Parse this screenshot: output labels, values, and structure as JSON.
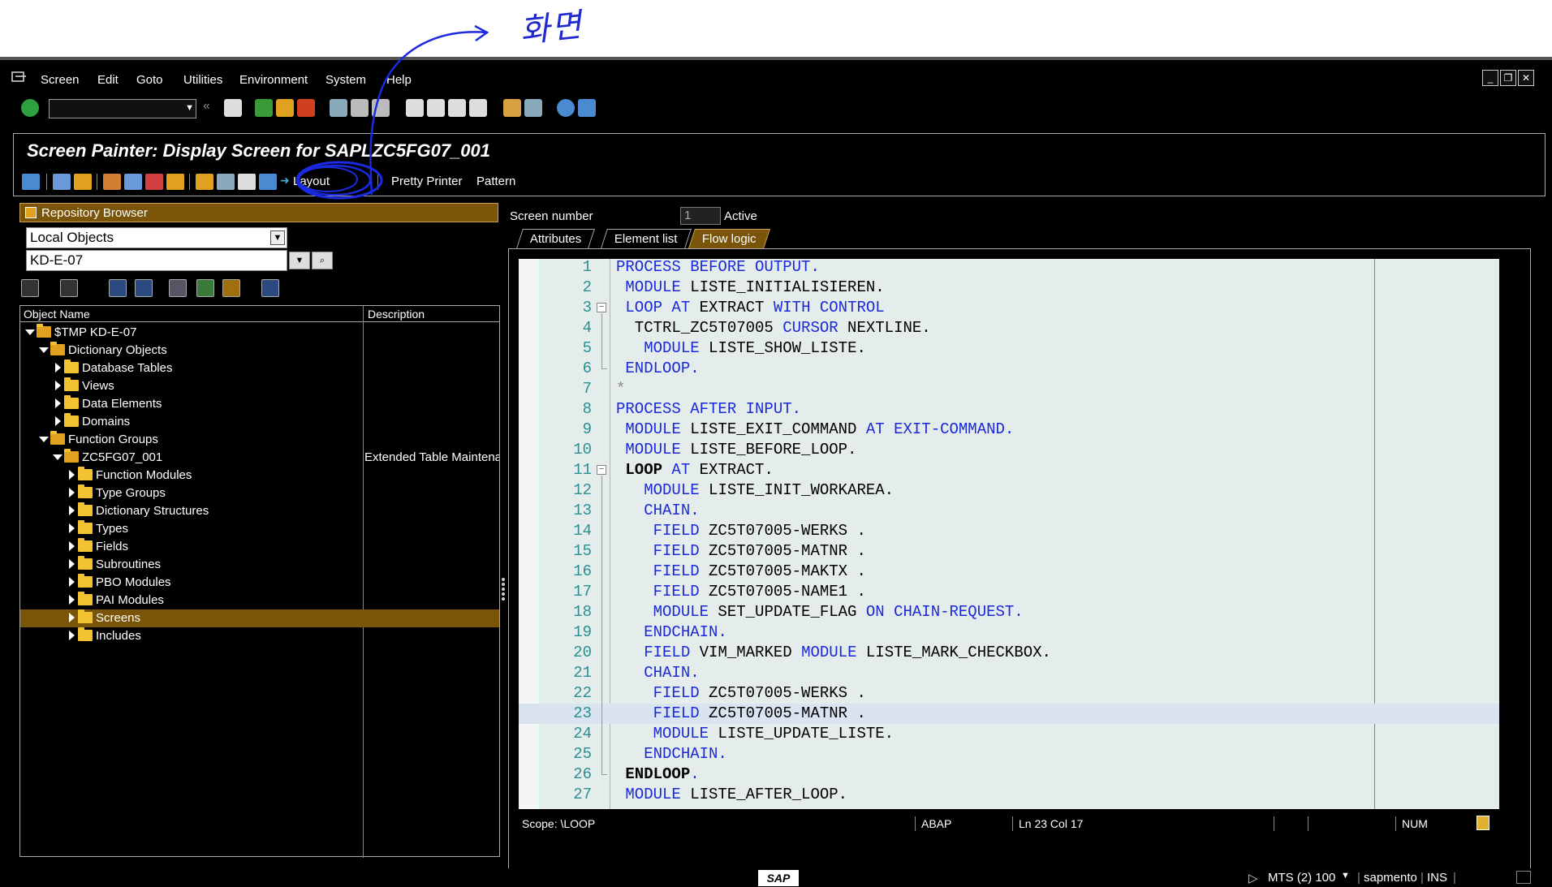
{
  "annotation": {
    "handwriting": "화면"
  },
  "menubar": {
    "items": [
      "Screen",
      "Edit",
      "Goto",
      "Utilities",
      "Environment",
      "System",
      "Help"
    ]
  },
  "toolbar": {
    "command_value": ""
  },
  "title": "Screen Painter: Display Screen for SAPLZC5FG07_001",
  "app_toolbar": {
    "layout_label": "Layout",
    "pretty_printer_label": "Pretty Printer",
    "pattern_label": "Pattern"
  },
  "repository_browser": {
    "header": "Repository Browser",
    "object_list_type": "Local Objects",
    "object_name": "KD-E-07",
    "columns": [
      "Object Name",
      "Description"
    ],
    "tree": [
      {
        "label": "$TMP KD-E-07",
        "level": 0,
        "expanded": true,
        "desc": ""
      },
      {
        "label": "Dictionary Objects",
        "level": 1,
        "expanded": true,
        "desc": ""
      },
      {
        "label": "Database Tables",
        "level": 2,
        "expanded": false,
        "desc": ""
      },
      {
        "label": "Views",
        "level": 2,
        "expanded": false,
        "desc": ""
      },
      {
        "label": "Data Elements",
        "level": 2,
        "expanded": false,
        "desc": ""
      },
      {
        "label": "Domains",
        "level": 2,
        "expanded": false,
        "desc": ""
      },
      {
        "label": "Function Groups",
        "level": 1,
        "expanded": true,
        "desc": ""
      },
      {
        "label": "ZC5FG07_001",
        "level": 2,
        "expanded": true,
        "desc": "Extended Table Maintena"
      },
      {
        "label": "Function Modules",
        "level": 3,
        "expanded": false,
        "desc": ""
      },
      {
        "label": "Type Groups",
        "level": 3,
        "expanded": false,
        "desc": ""
      },
      {
        "label": "Dictionary Structures",
        "level": 3,
        "expanded": false,
        "desc": ""
      },
      {
        "label": "Types",
        "level": 3,
        "expanded": false,
        "desc": ""
      },
      {
        "label": "Fields",
        "level": 3,
        "expanded": false,
        "desc": ""
      },
      {
        "label": "Subroutines",
        "level": 3,
        "expanded": false,
        "desc": ""
      },
      {
        "label": "PBO Modules",
        "level": 3,
        "expanded": false,
        "desc": ""
      },
      {
        "label": "PAI Modules",
        "level": 3,
        "expanded": false,
        "desc": ""
      },
      {
        "label": "Screens",
        "level": 3,
        "expanded": false,
        "desc": "",
        "selected": true
      },
      {
        "label": "Includes",
        "level": 3,
        "expanded": false,
        "desc": ""
      }
    ]
  },
  "screen": {
    "number_label": "Screen number",
    "number_value": "1",
    "status": "Active",
    "tabs": [
      "Attributes",
      "Element list",
      "Flow logic"
    ],
    "active_tab": 2
  },
  "code": [
    {
      "n": "1",
      "fold": "",
      "html": "<span class='kw'>PROCESS BEFORE OUTPUT.</span>"
    },
    {
      "n": "2",
      "fold": "",
      "html": " <span class='kw'>MODULE</span> LISTE_INITIALISIEREN."
    },
    {
      "n": "3",
      "fold": "open",
      "html": " <span class='kw'>LOOP AT</span> EXTRACT <span class='kw'>WITH CONTROL</span>"
    },
    {
      "n": "4",
      "fold": "",
      "html": "  TCTRL_ZC5T07005 <span class='kw'>CURSOR</span> NEXTLINE."
    },
    {
      "n": "5",
      "fold": "",
      "html": "   <span class='kw'>MODULE</span> LISTE_SHOW_LISTE."
    },
    {
      "n": "6",
      "fold": "end",
      "html": " <span class='kw'>ENDLOOP.</span>"
    },
    {
      "n": "7",
      "fold": "",
      "html": "<span class='cm'>*</span>"
    },
    {
      "n": "8",
      "fold": "",
      "html": "<span class='kw'>PROCESS AFTER INPUT.</span>"
    },
    {
      "n": "9",
      "fold": "",
      "html": " <span class='kw'>MODULE</span> LISTE_EXIT_COMMAND <span class='kw'>AT EXIT-COMMAND.</span>"
    },
    {
      "n": "10",
      "fold": "",
      "html": " <span class='kw'>MODULE</span> LISTE_BEFORE_LOOP."
    },
    {
      "n": "11",
      "fold": "open",
      "html": " <span class='bold'>LOOP</span> <span class='kw'>AT</span> EXTRACT."
    },
    {
      "n": "12",
      "fold": "",
      "html": "   <span class='kw'>MODULE</span> LISTE_INIT_WORKAREA."
    },
    {
      "n": "13",
      "fold": "",
      "html": "   <span class='kw'>CHAIN.</span>"
    },
    {
      "n": "14",
      "fold": "",
      "html": "    <span class='kw'>FIELD</span> ZC5T07005-WERKS ."
    },
    {
      "n": "15",
      "fold": "",
      "html": "    <span class='kw'>FIELD</span> ZC5T07005-MATNR ."
    },
    {
      "n": "16",
      "fold": "",
      "html": "    <span class='kw'>FIELD</span> ZC5T07005-MAKTX ."
    },
    {
      "n": "17",
      "fold": "",
      "html": "    <span class='kw'>FIELD</span> ZC5T07005-NAME1 ."
    },
    {
      "n": "18",
      "fold": "",
      "html": "    <span class='kw'>MODULE</span> SET_UPDATE_FLAG <span class='kw'>ON CHAIN-REQUEST.</span>"
    },
    {
      "n": "19",
      "fold": "",
      "html": "   <span class='kw'>ENDCHAIN.</span>"
    },
    {
      "n": "20",
      "fold": "",
      "html": "   <span class='kw'>FIELD</span> VIM_MARKED <span class='kw'>MODULE</span> LISTE_MARK_CHECKBOX."
    },
    {
      "n": "21",
      "fold": "",
      "html": "   <span class='kw'>CHAIN.</span>"
    },
    {
      "n": "22",
      "fold": "",
      "html": "    <span class='kw'>FIELD</span> ZC5T07005-WERKS ."
    },
    {
      "n": "23",
      "fold": "",
      "html": "    <span class='kw'>FIELD</span> ZC5T07005-MATNR .",
      "highlight": true
    },
    {
      "n": "24",
      "fold": "",
      "html": "    <span class='kw'>MODULE</span> LISTE_UPDATE_LISTE."
    },
    {
      "n": "25",
      "fold": "",
      "html": "   <span class='kw'>ENDCHAIN.</span>"
    },
    {
      "n": "26",
      "fold": "end",
      "html": " <span class='bold'>ENDLOOP</span><span class='kw'>.</span>"
    },
    {
      "n": "27",
      "fold": "",
      "html": " <span class='kw'>MODULE</span> LISTE_AFTER_LOOP."
    }
  ],
  "editor_status": {
    "scope": "Scope: \\LOOP",
    "language": "ABAP",
    "position": "Ln  23 Col  17",
    "num": "NUM"
  },
  "statusbar": {
    "logo": "SAP",
    "system": "MTS (2) 100",
    "host": "sapmento",
    "mode": "INS"
  },
  "colors": {
    "accent": "#7a5408",
    "keyword": "#1a2ad8",
    "annotation": "#2028d0"
  }
}
